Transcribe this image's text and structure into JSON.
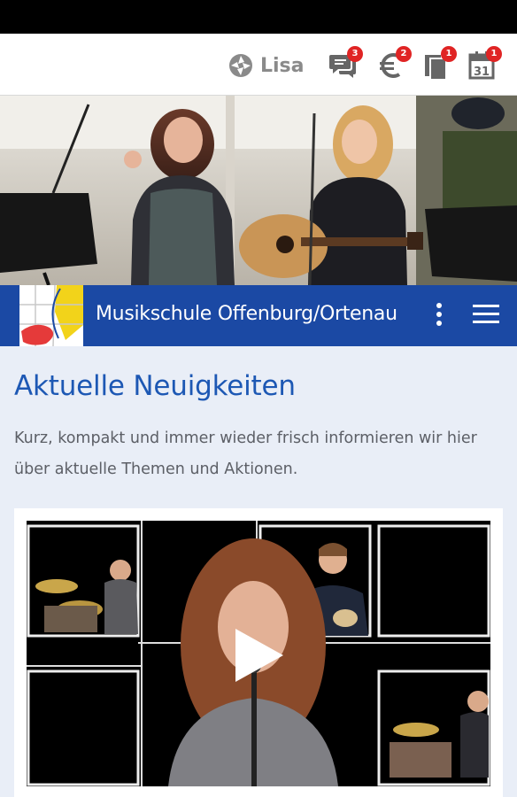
{
  "top_bar": {
    "user_name": "Lisa",
    "badges": {
      "messages": "3",
      "payments": "2",
      "documents": "1",
      "calendar": "1"
    },
    "calendar_day": "31"
  },
  "brand": {
    "title": "Musikschule Offenburg/Ortenau"
  },
  "news": {
    "headline": "Aktuelle Neuigkeiten",
    "intro": "Kurz, kompakt und immer wieder frisch informieren wir hier über aktuelle Themen und Aktionen."
  },
  "colors": {
    "brand_blue": "#1b49a4",
    "headline_blue": "#1d58b4",
    "badge_red": "#e02424",
    "page_bg": "#e9eef7"
  },
  "icons": [
    "logo-mark-icon",
    "chat-icon",
    "euro-icon",
    "documents-icon",
    "calendar-icon",
    "more-vert-icon",
    "menu-icon",
    "play-icon"
  ]
}
